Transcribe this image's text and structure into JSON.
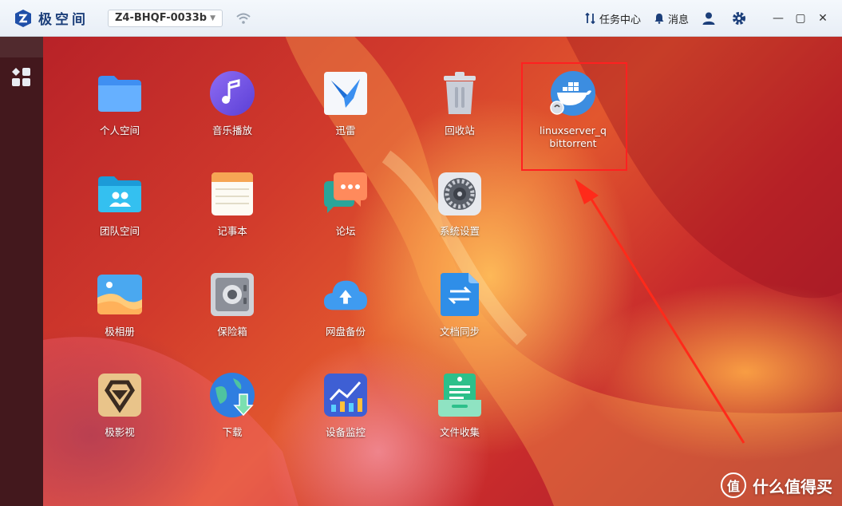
{
  "app": {
    "title": "极空间"
  },
  "device": {
    "name": "Z4-BHQF-0033b"
  },
  "topbar": {
    "task_center": "任务中心",
    "messages": "消息"
  },
  "apps": [
    {
      "label": "个人空间",
      "icon": "folder-icon"
    },
    {
      "label": "音乐播放",
      "icon": "music-icon"
    },
    {
      "label": "迅雷",
      "icon": "thunder-bird-icon"
    },
    {
      "label": "回收站",
      "icon": "trash-icon"
    },
    {
      "label": "linuxserver_q\nbittorrent",
      "icon": "docker-whale-icon"
    },
    {
      "label": "团队空间",
      "icon": "team-folder-icon"
    },
    {
      "label": "记事本",
      "icon": "notepad-icon"
    },
    {
      "label": "论坛",
      "icon": "forum-chat-icon"
    },
    {
      "label": "系统设置",
      "icon": "gear-icon"
    },
    {
      "label": "极相册",
      "icon": "photo-album-icon"
    },
    {
      "label": "保险箱",
      "icon": "safe-icon"
    },
    {
      "label": "网盘备份",
      "icon": "cloud-upload-icon"
    },
    {
      "label": "文档同步",
      "icon": "sync-icon"
    },
    {
      "label": "极影视",
      "icon": "video-icon"
    },
    {
      "label": "下载",
      "icon": "download-globe-icon"
    },
    {
      "label": "设备监控",
      "icon": "chart-monitor-icon"
    },
    {
      "label": "文件收集",
      "icon": "file-collect-icon"
    }
  ],
  "watermark": {
    "badge": "值",
    "text": "什么值得买"
  },
  "colors": {
    "accent": "#2b6fd6",
    "highlight": "#ff2020"
  }
}
